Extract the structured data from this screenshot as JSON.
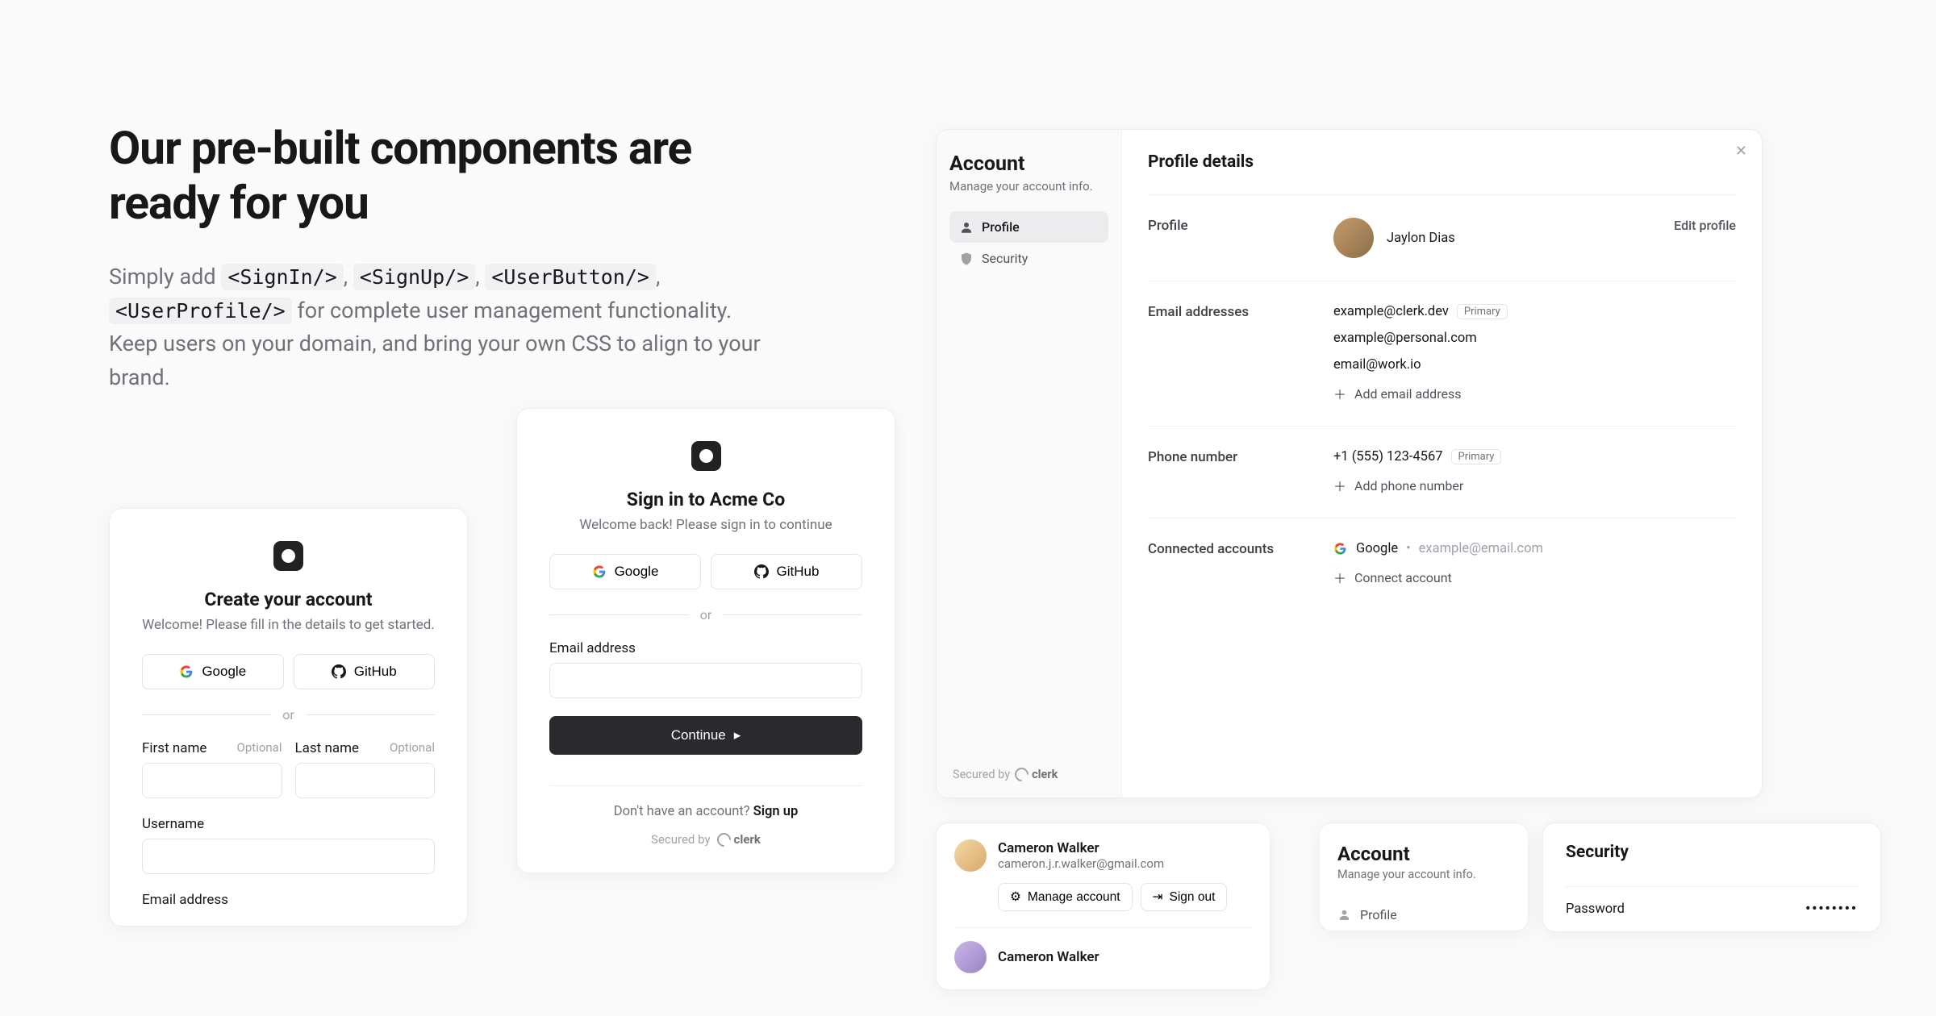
{
  "hero": {
    "title": "Our pre-built components are ready for you",
    "lead1": "Simply add ",
    "code1": "<SignIn/>",
    "code2": "<SignUp/>",
    "code3": "<UserButton/>",
    "code4": "<UserProfile/>",
    "lead2": " for complete user management functionality. Keep users on your domain, and bring your own CSS to align to your brand."
  },
  "signup": {
    "title": "Create your account",
    "subtitle": "Welcome! Please fill in the details to get started.",
    "social": {
      "google": "Google",
      "github": "GitHub"
    },
    "or": "or",
    "fields": {
      "first": "First name",
      "last": "Last name",
      "username": "Username",
      "email": "Email address",
      "optional": "Optional"
    }
  },
  "signin": {
    "title": "Sign in to Acme Co",
    "subtitle": "Welcome back! Please sign in to continue",
    "social": {
      "google": "Google",
      "github": "GitHub"
    },
    "or": "or",
    "email_label": "Email address",
    "continue": "Continue",
    "no_account": "Don't have an account? ",
    "signup_link": "Sign up",
    "secured": "Secured by",
    "brand": "clerk"
  },
  "profile": {
    "sidebar_title": "Account",
    "sidebar_sub": "Manage your account info.",
    "nav": {
      "profile": "Profile",
      "security": "Security"
    },
    "title": "Profile details",
    "sections": {
      "profile": {
        "label": "Profile",
        "name": "Jaylon Dias",
        "edit": "Edit profile"
      },
      "emails": {
        "label": "Email addresses",
        "list": [
          {
            "value": "example@clerk.dev",
            "primary": true
          },
          {
            "value": "example@personal.com",
            "primary": false
          },
          {
            "value": "email@work.io",
            "primary": false
          }
        ],
        "add": "Add email address"
      },
      "phone": {
        "label": "Phone number",
        "list": [
          {
            "value": "+1 (555) 123-4567",
            "primary": true
          }
        ],
        "add": "Add phone number"
      },
      "connected": {
        "label": "Connected accounts",
        "provider": "Google",
        "email": "example@email.com",
        "add": "Connect account"
      }
    },
    "primary_badge": "Primary",
    "secured": "Secured by",
    "brand": "clerk"
  },
  "userbutton": {
    "name": "Cameron Walker",
    "email": "cameron.j.r.walker@gmail.com",
    "manage": "Manage account",
    "signout": "Sign out",
    "name2": "Cameron Walker"
  },
  "account2": {
    "title": "Account",
    "sub": "Manage your account info.",
    "profile": "Profile"
  },
  "security": {
    "title": "Security",
    "password_label": "Password",
    "password_mask": "••••••••"
  }
}
